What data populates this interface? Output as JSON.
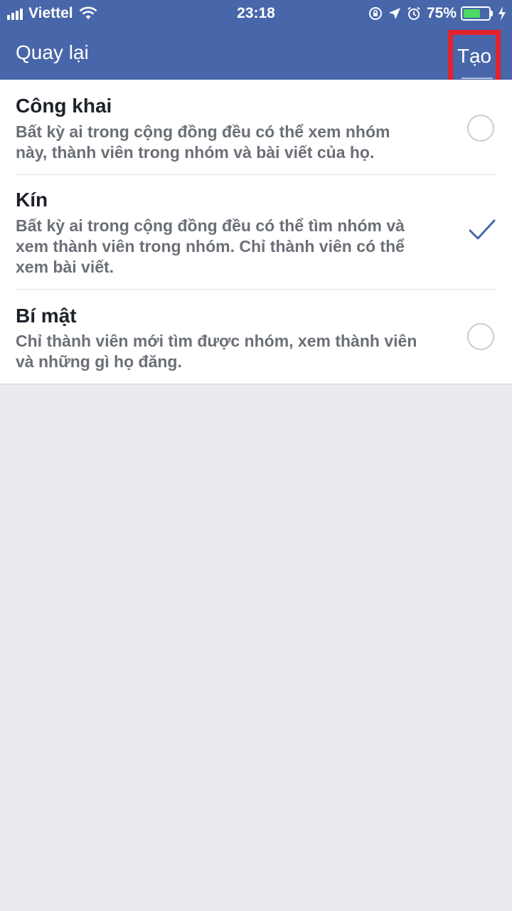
{
  "status_bar": {
    "carrier": "Viettel",
    "time": "23:18",
    "battery_percent": "75%",
    "battery_level": 0.75,
    "icons": [
      "signal-icon",
      "wifi-icon",
      "rotation-lock-icon",
      "location-icon",
      "alarm-icon",
      "battery-icon",
      "charging-icon"
    ]
  },
  "nav": {
    "back_label": "Quay lại",
    "create_label": "Tạo",
    "highlight_color": "#e3232c",
    "bar_color": "#4867aa"
  },
  "options": [
    {
      "title": "Công khai",
      "desc_line1": "Bất kỳ ai trong cộng đồng đều có thể xem nhóm",
      "desc_line2": "này, thành viên trong nhóm và bài viết của họ.",
      "selected": false
    },
    {
      "title": "Kín",
      "desc_line1": "Bất kỳ ai trong cộng đồng đều có thể tìm nhóm và",
      "desc_line2": "xem thành viên trong nhóm. Chỉ thành viên có thể",
      "desc_line3": "xem bài viết.",
      "selected": true
    },
    {
      "title": "Bí mật",
      "desc_line1": "Chỉ thành viên mới tìm được nhóm, xem thành viên",
      "desc_line2": "và những gì họ đăng.",
      "selected": false
    }
  ],
  "colors": {
    "check": "#4867aa",
    "background": "#e9ebee"
  }
}
